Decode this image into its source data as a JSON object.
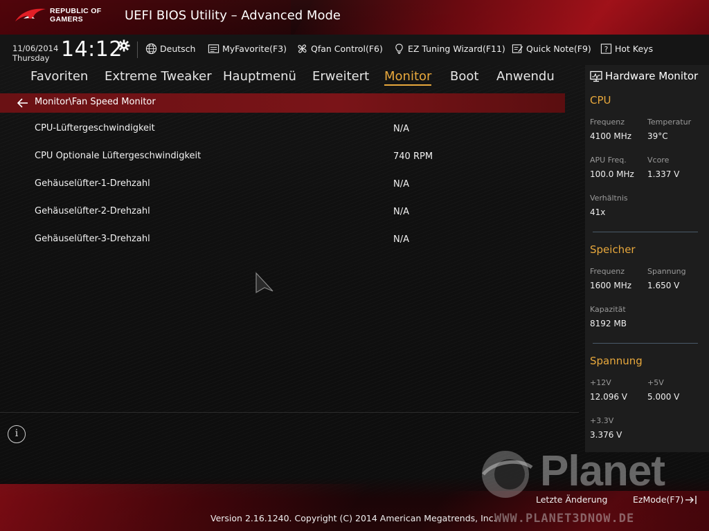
{
  "header": {
    "logo_line1": "REPUBLIC OF",
    "logo_line2": "GAMERS",
    "title": "UEFI BIOS Utility – Advanced Mode"
  },
  "infobar": {
    "date": "11/06/2014",
    "day": "Thursday",
    "time": "14:12",
    "tools": [
      {
        "label": "Deutsch",
        "icon": "globe-icon"
      },
      {
        "label": "MyFavorite(F3)",
        "icon": "favorite-list-icon"
      },
      {
        "label": "Qfan Control(F6)",
        "icon": "fan-icon"
      },
      {
        "label": "EZ Tuning Wizard(F11)",
        "icon": "lightbulb-icon"
      },
      {
        "label": "Quick Note(F9)",
        "icon": "note-icon"
      },
      {
        "label": "Hot Keys",
        "icon": "question-box-icon"
      }
    ]
  },
  "nav": {
    "tabs": [
      {
        "label": "Favoriten"
      },
      {
        "label": "Extreme Tweaker"
      },
      {
        "label": "Hauptmenü"
      },
      {
        "label": "Erweitert"
      },
      {
        "label": "Monitor",
        "active": true
      },
      {
        "label": "Boot"
      },
      {
        "label": "Anwendu"
      }
    ]
  },
  "breadcrumb": "Monitor\\Fan Speed Monitor",
  "rows": [
    {
      "label": "CPU-Lüftergeschwindigkeit",
      "value": "N/A"
    },
    {
      "label": "CPU Optionale Lüftergeschwindigkeit",
      "value": "740 RPM"
    },
    {
      "label": "Gehäuselüfter-1-Drehzahl",
      "value": "N/A"
    },
    {
      "label": "Gehäuselüfter-2-Drehzahl",
      "value": "N/A"
    },
    {
      "label": "Gehäuselüfter-3-Drehzahl",
      "value": "N/A"
    }
  ],
  "hardware_monitor": {
    "title": "Hardware Monitor",
    "cpu": {
      "heading": "CPU",
      "freq_label": "Frequenz",
      "freq_value": "4100 MHz",
      "temp_label": "Temperatur",
      "temp_value": "39°C",
      "apu_label": "APU Freq.",
      "apu_value": "100.0 MHz",
      "vcore_label": "Vcore",
      "vcore_value": "1.337 V",
      "ratio_label": "Verhältnis",
      "ratio_value": "41x"
    },
    "memory": {
      "heading": "Speicher",
      "freq_label": "Frequenz",
      "freq_value": "1600 MHz",
      "volt_label": "Spannung",
      "volt_value": "1.650 V",
      "cap_label": "Kapazität",
      "cap_value": "8192 MB"
    },
    "voltage": {
      "heading": "Spannung",
      "v12_label": "+12V",
      "v12_value": "12.096 V",
      "v5_label": "+5V",
      "v5_value": "5.000 V",
      "v33_label": "+3.3V",
      "v33_value": "3.376 V"
    }
  },
  "footer": {
    "last_change": "Letzte Änderung",
    "ezmode": "EzMode(F7)",
    "version": "Version 2.16.1240. Copyright (C) 2014 American Megatrends, Inc.",
    "watermark_name": "Planet",
    "watermark_url": "WWW.PLANET3DNOW.DE"
  },
  "colors": {
    "accent": "#e8a83c",
    "breadcrumb_bg": "#7a1418",
    "panel_bg": "#1d1d1d"
  }
}
